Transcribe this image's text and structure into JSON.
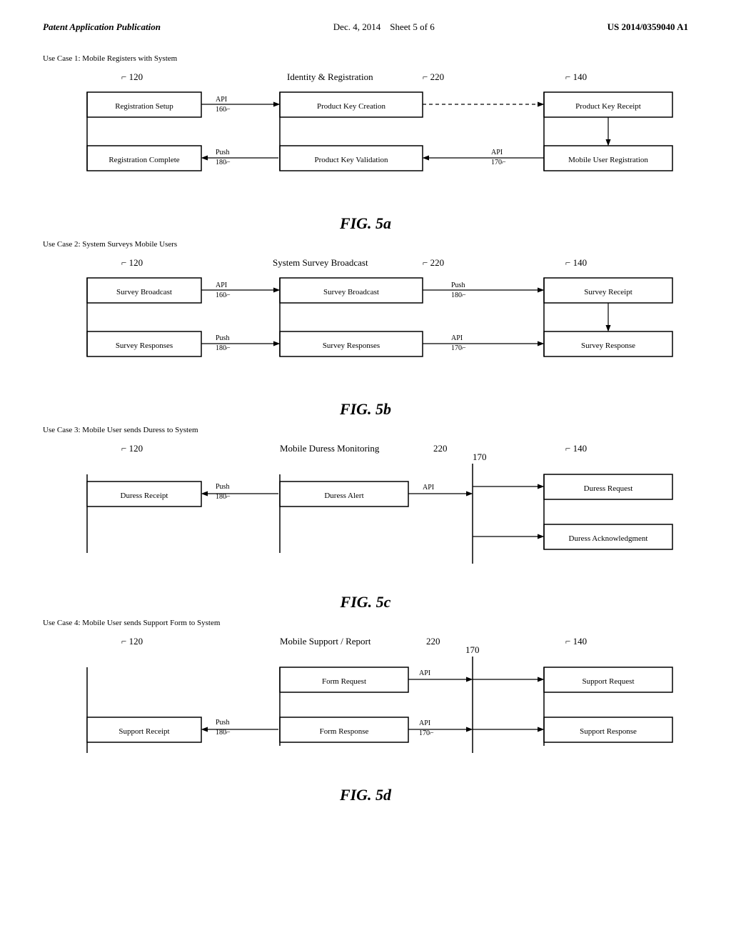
{
  "header": {
    "left": "Patent Application Publication",
    "center_date": "Dec. 4, 2014",
    "center_sheet": "Sheet 5 of 6",
    "right": "US 2014/0359040 A1"
  },
  "diagrams": [
    {
      "id": "fig5a",
      "use_case_label": "Use Case 1: Mobile Registers with System",
      "fig_label": "FIG. 5a",
      "columns": [
        {
          "id": 120,
          "label": ""
        },
        {
          "id": null,
          "label": "Identity & Registration",
          "group_id": 220
        },
        {
          "id": 140,
          "label": ""
        }
      ]
    },
    {
      "id": "fig5b",
      "use_case_label": "Use Case 2: System Surveys Mobile Users",
      "fig_label": "FIG. 5b"
    },
    {
      "id": "fig5c",
      "use_case_label": "Use Case 3: Mobile User sends Duress to System",
      "fig_label": "FIG. 5c"
    },
    {
      "id": "fig5d",
      "use_case_label": "Use Case 4: Mobile User sends Support Form to System",
      "fig_label": "FIG. 5d"
    }
  ]
}
